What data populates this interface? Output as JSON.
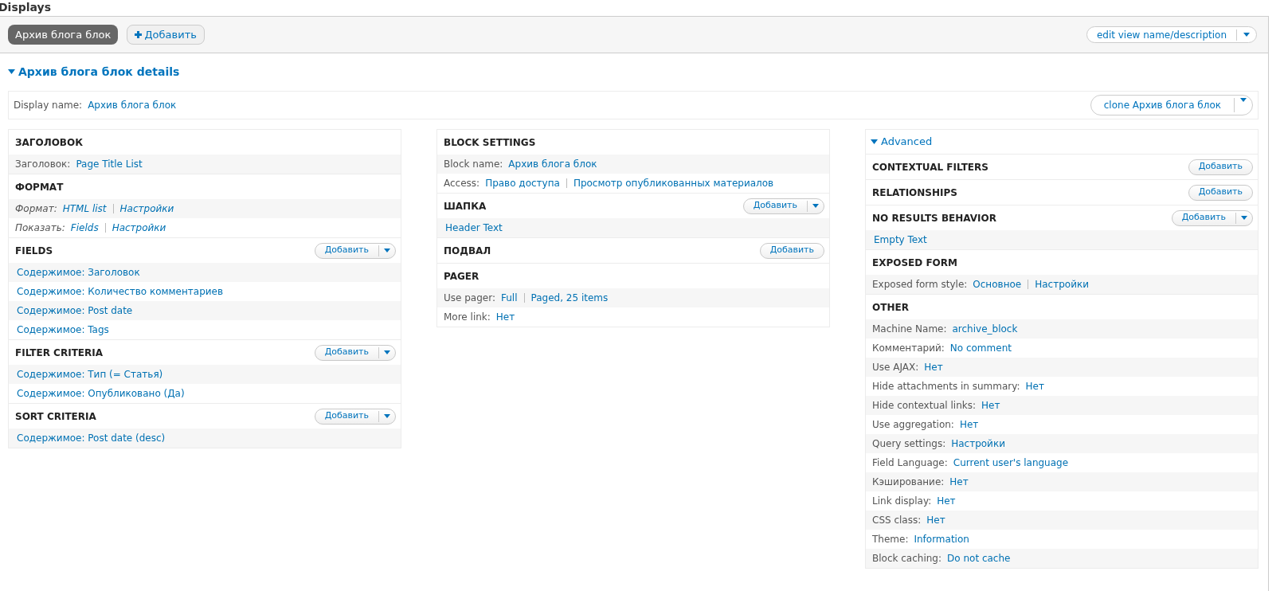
{
  "title": "Displays",
  "display_tabs": [
    {
      "label": "Архив блога блок",
      "selected": true
    }
  ],
  "add_display_button": "Добавить",
  "edit_button": "edit view name/description",
  "details": {
    "title": "Архив блога блок details",
    "expanded": true,
    "display_name": {
      "label": "Display name:",
      "value": "Архив блога блок"
    },
    "clone_button": "clone Архив блога блок"
  },
  "columns": [
    {
      "sections": [
        {
          "title": "ЗАГОЛОВОК",
          "rows": [
            {
              "kind": "setting",
              "label": "Заголовок:",
              "links": [
                "Page Title List"
              ]
            }
          ]
        },
        {
          "title": "ФОРМАТ",
          "rows": [
            {
              "kind": "style",
              "label": "Формат:",
              "links": [
                "HTML list",
                "Настройки"
              ]
            },
            {
              "kind": "style",
              "label": "Показать:",
              "links": [
                "Fields",
                "Настройки"
              ]
            }
          ]
        },
        {
          "title": "FIELDS",
          "add": {
            "label": "Добавить",
            "dropdown": true
          },
          "rows": [
            {
              "kind": "item",
              "links": [
                "Содержимое: Заголовок"
              ]
            },
            {
              "kind": "item",
              "links": [
                "Содержимое: Количество комментариев"
              ]
            },
            {
              "kind": "item",
              "links": [
                "Содержимое: Post date"
              ]
            },
            {
              "kind": "item",
              "links": [
                "Содержимое: Tags"
              ]
            }
          ]
        },
        {
          "title": "FILTER CRITERIA",
          "add": {
            "label": "Добавить",
            "dropdown": true
          },
          "rows": [
            {
              "kind": "item",
              "links": [
                "Содержимое: Тип (= Статья)"
              ]
            },
            {
              "kind": "item",
              "links": [
                "Содержимое: Опубликовано (Да)"
              ]
            }
          ]
        },
        {
          "title": "SORT CRITERIA",
          "add": {
            "label": "Добавить",
            "dropdown": true
          },
          "rows": [
            {
              "kind": "item",
              "links": [
                "Содержимое: Post date (desc)"
              ]
            }
          ]
        }
      ]
    },
    {
      "sections": [
        {
          "title": "BLOCK SETTINGS",
          "rows": [
            {
              "kind": "setting",
              "label": "Block name:",
              "links": [
                "Архив блога блок"
              ]
            },
            {
              "kind": "setting",
              "label": "Access:",
              "links": [
                "Право доступа",
                "Просмотр опубликованных материалов"
              ]
            }
          ]
        },
        {
          "title": "ШАПКА",
          "add": {
            "label": "Добавить",
            "dropdown": true
          },
          "rows": [
            {
              "kind": "item",
              "links": [
                "Header Text"
              ]
            }
          ]
        },
        {
          "title": "ПОДВАЛ",
          "add": {
            "label": "Добавить",
            "dropdown": false
          }
        },
        {
          "title": "PAGER",
          "rows": [
            {
              "kind": "setting",
              "label": "Use pager:",
              "links": [
                "Full",
                "Paged, 25 items"
              ]
            },
            {
              "kind": "setting",
              "label": "More link:",
              "links": [
                "Нет"
              ]
            }
          ]
        }
      ]
    },
    {
      "toggle": {
        "label": "Advanced",
        "expanded": true
      },
      "sections": [
        {
          "title": "CONTEXTUAL FILTERS",
          "add": {
            "label": "Добавить",
            "dropdown": false
          }
        },
        {
          "title": "RELATIONSHIPS",
          "add": {
            "label": "Добавить",
            "dropdown": false
          }
        },
        {
          "title": "NO RESULTS BEHAVIOR",
          "add": {
            "label": "Добавить",
            "dropdown": true
          },
          "rows": [
            {
              "kind": "item",
              "links": [
                "Empty Text"
              ]
            }
          ]
        },
        {
          "title": "EXPOSED FORM",
          "rows": [
            {
              "kind": "setting",
              "label": "Exposed form style:",
              "links": [
                "Основное",
                "Настройки"
              ]
            }
          ]
        },
        {
          "title": "OTHER",
          "rows": [
            {
              "kind": "setting",
              "label": "Machine Name:",
              "links": [
                "archive_block"
              ]
            },
            {
              "kind": "setting",
              "label": "Комментарий:",
              "links": [
                "No comment"
              ]
            },
            {
              "kind": "setting",
              "label": "Use AJAX:",
              "links": [
                "Нет"
              ]
            },
            {
              "kind": "setting",
              "label": "Hide attachments in summary:",
              "links": [
                "Нет"
              ]
            },
            {
              "kind": "setting",
              "label": "Hide contextual links:",
              "links": [
                "Нет"
              ]
            },
            {
              "kind": "setting",
              "label": "Use aggregation:",
              "links": [
                "Нет"
              ]
            },
            {
              "kind": "setting",
              "label": "Query settings:",
              "links": [
                "Настройки"
              ]
            },
            {
              "kind": "setting",
              "label": "Field Language:",
              "links": [
                "Current user's language"
              ]
            },
            {
              "kind": "setting",
              "label": "Кэширование:",
              "links": [
                "Нет"
              ]
            },
            {
              "kind": "setting",
              "label": "Link display:",
              "links": [
                "Нет"
              ]
            },
            {
              "kind": "setting",
              "label": "CSS class:",
              "links": [
                "Нет"
              ]
            },
            {
              "kind": "setting",
              "label": "Theme:",
              "links": [
                "Information"
              ]
            },
            {
              "kind": "setting",
              "label": "Block caching:",
              "links": [
                "Do not cache"
              ]
            }
          ]
        }
      ]
    }
  ]
}
